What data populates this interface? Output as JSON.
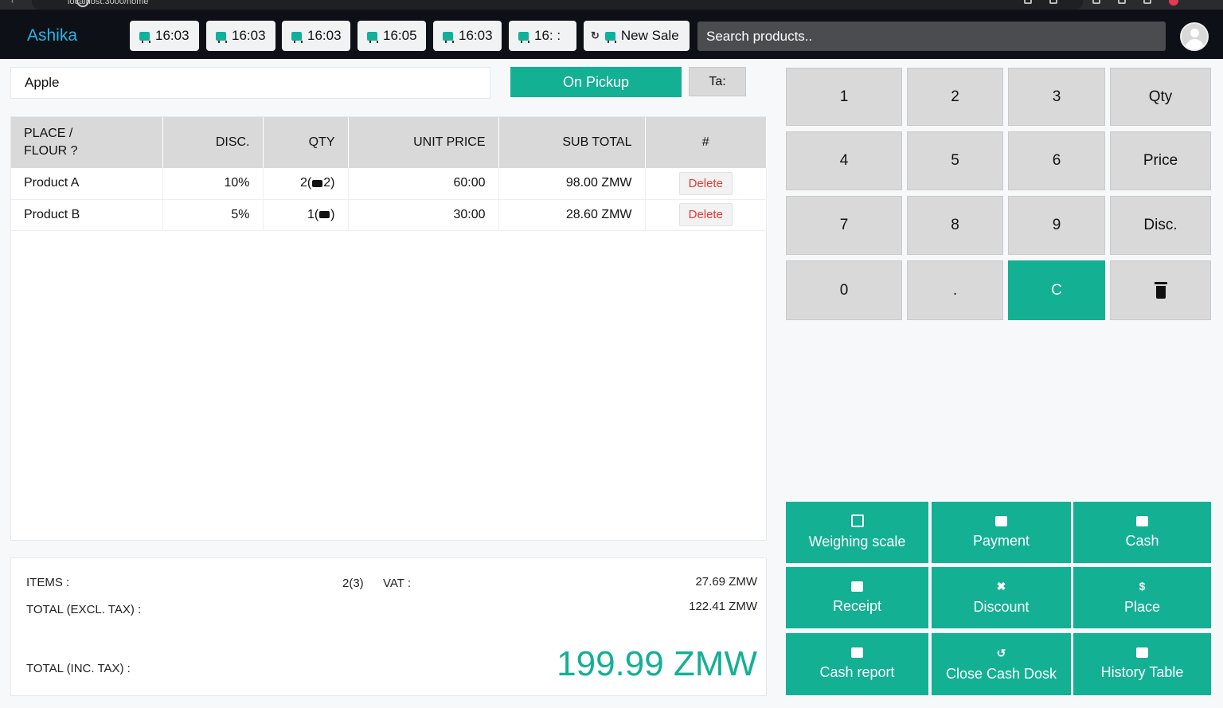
{
  "browser": {
    "url": "localhost:3000/home"
  },
  "brand": "Ashika",
  "tabs": [
    {
      "label": "16:03"
    },
    {
      "label": "16:03"
    },
    {
      "label": "16:03"
    },
    {
      "label": "16:05"
    },
    {
      "label": "16:03"
    },
    {
      "label": "16: :"
    },
    {
      "label": "New Sale"
    }
  ],
  "search": {
    "placeholder": "Search products.."
  },
  "customer": {
    "name": "Apple"
  },
  "order_mode": {
    "pickup_label": "On Pickup",
    "ta_label": "Ta:"
  },
  "table": {
    "headers": {
      "place_line1": "PLACE /",
      "place_line2": "FLOUR ?",
      "disc": "DISC.",
      "qty": "QTY",
      "unit_price": "UNIT PRICE",
      "sub_total": "SUB TOTAL",
      "action": "#"
    },
    "rows": [
      {
        "name": "Product A",
        "disc": "10%",
        "qty_pre": "2(",
        "qty_post": "2)",
        "unit_price": "60:00",
        "sub_total": "98.00 ZMW",
        "action": "Delete"
      },
      {
        "name": "Product B",
        "disc": "5%",
        "qty_pre": "1(",
        "qty_post": ")",
        "unit_price": "30:00",
        "sub_total": "28.60 ZMW",
        "action": "Delete"
      }
    ]
  },
  "totals": {
    "items_label": "ITEMS :",
    "items_value": "2(3)",
    "vat_label": "VAT :",
    "vat_value": "27.69 ZMW",
    "excl_label": "TOTAL (EXCL. TAX) :",
    "excl_value": "122.41 ZMW",
    "incl_label": "TOTAL (INC. TAX) :",
    "incl_value": "199.99 ZMW"
  },
  "keypad": {
    "k1": "1",
    "k2": "2",
    "k3": "3",
    "qty": "Qty",
    "k4": "4",
    "k5": "5",
    "k6": "6",
    "price": "Price",
    "k7": "7",
    "k8": "8",
    "k9": "9",
    "disc": "Disc.",
    "k0": "0",
    "dot": ".",
    "clear": "C",
    "delete_icon": "trash-icon"
  },
  "actions": {
    "weighing": "Weighing scale",
    "payment": "Payment",
    "cash": "Cash",
    "receipt": "Receipt",
    "discount": "Discount",
    "place_symbol": "$",
    "place": "Place",
    "cash_report": "Cash report",
    "close_cash": "Close Cash Dosk",
    "history": "History Table"
  },
  "colors": {
    "accent": "#13b094",
    "brand": "#28b4e6",
    "topbar": "#0d1117",
    "delete": "#e53935"
  }
}
